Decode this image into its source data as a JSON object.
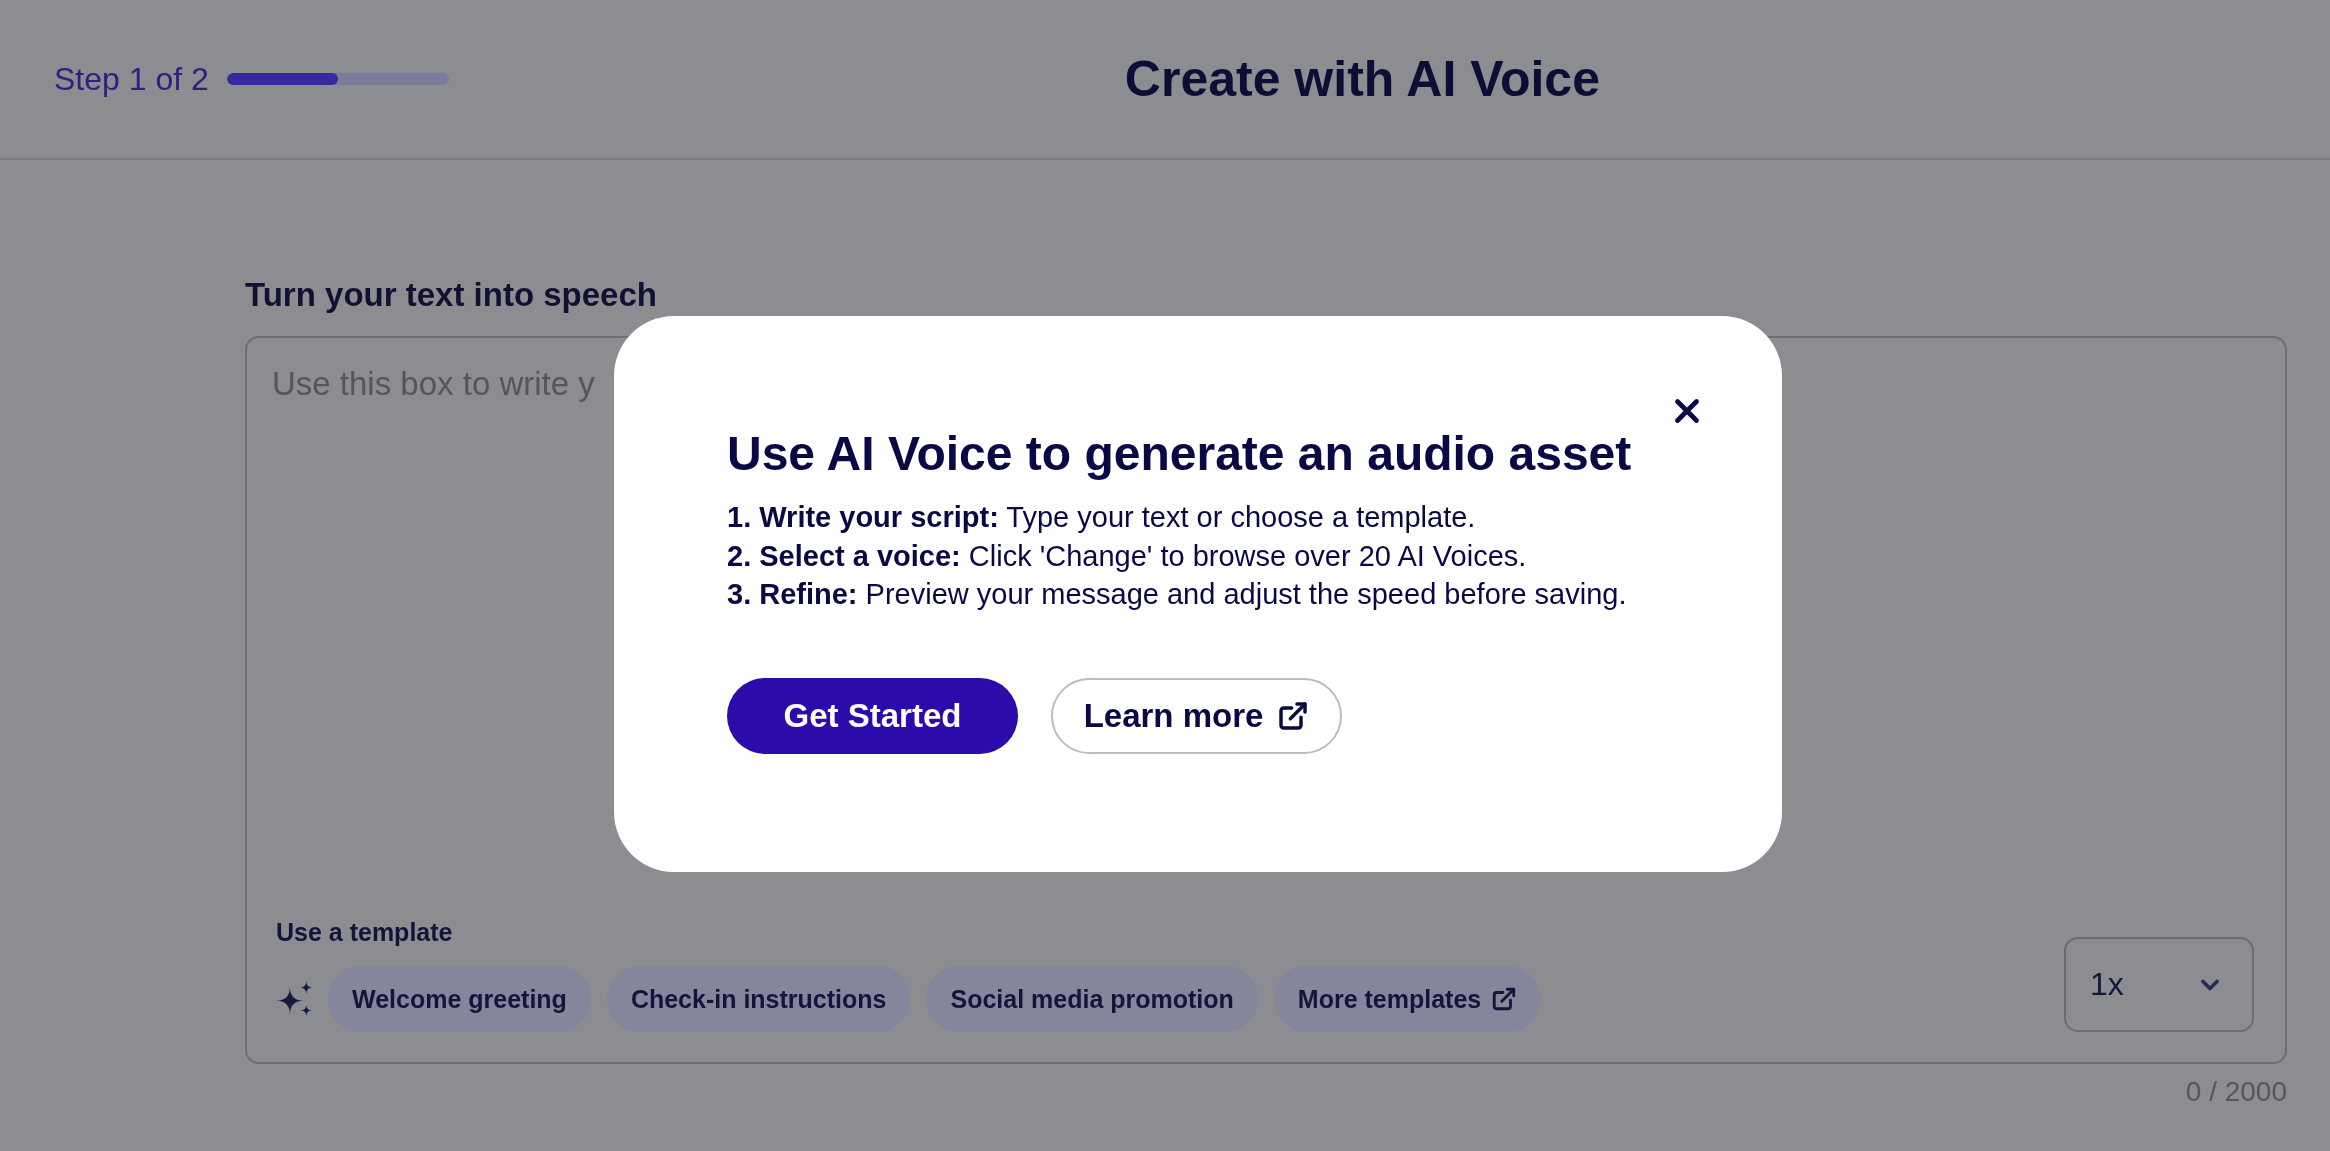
{
  "header": {
    "step_label": "Step 1 of 2",
    "progress": {
      "level": 0.5
    },
    "title": "Create with AI Voice"
  },
  "section_title": "Turn your text into speech",
  "script_box": {
    "placeholder": "Use this box to write y",
    "template_label": "Use a template",
    "templates": [
      {
        "label": "Welcome greeting",
        "kind": "template"
      },
      {
        "label": "Check-in instructions",
        "kind": "template"
      },
      {
        "label": "Social media promotion",
        "kind": "template"
      },
      {
        "label": "More templates",
        "kind": "link"
      }
    ],
    "speed": {
      "value": "1x"
    },
    "char_count": "0 / 2000"
  },
  "modal": {
    "title": "Use AI Voice to generate an audio asset",
    "steps": [
      "**1. Write your script:** Type your text or choose a template.",
      "**2. Select a voice:** Click 'Change' to browse over 20 AI Voices.",
      "**3. Refine:** Preview your message and adjust the speed before saving."
    ],
    "buttons": [
      {
        "label": "Get Started",
        "kind": "primary"
      },
      {
        "label": "Learn more",
        "kind": "external"
      }
    ]
  }
}
